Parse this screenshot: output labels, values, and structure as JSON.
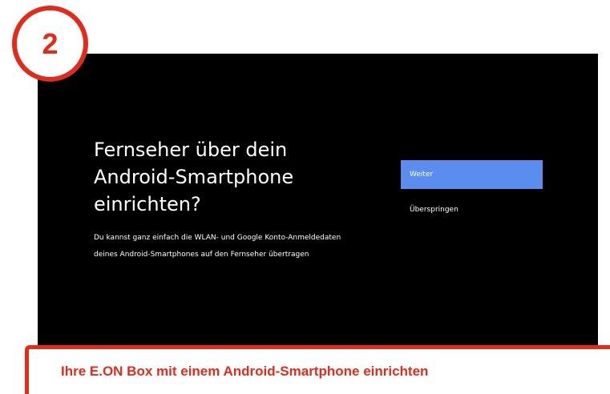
{
  "step": {
    "number": "2"
  },
  "screen": {
    "headline": "Fernseher über dein Android-Smartphone einrichten?",
    "description_line1": "Du kannst ganz einfach die WLAN- und Google Konto-Anmeldedaten",
    "description_line2": "deines Android-Smartphones auf den Fernseher übertragen",
    "continue_label": "Weiter",
    "skip_label": "Überspringen"
  },
  "caption": {
    "text": "Ihre E.ON Box mit einem Android-Smartphone einrichten"
  },
  "colors": {
    "accent_red": "#e32b1b",
    "button_blue": "#5b8def",
    "screen_bg": "#000000"
  }
}
